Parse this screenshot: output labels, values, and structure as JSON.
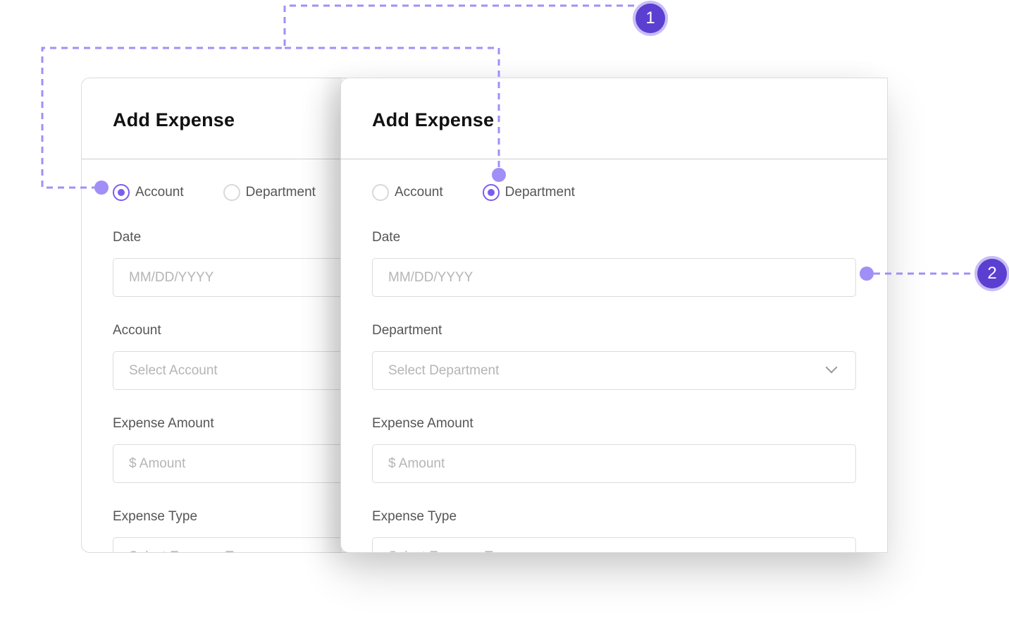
{
  "cards": [
    {
      "title": "Add Expense",
      "radios": [
        {
          "label": "Account",
          "selected": true
        },
        {
          "label": "Department",
          "selected": false
        }
      ],
      "fields": [
        {
          "label": "Date",
          "placeholder": "MM/DD/YYYY"
        },
        {
          "label": "Account",
          "placeholder": "Select Account"
        },
        {
          "label": "Expense Amount",
          "placeholder": "$ Amount"
        },
        {
          "label": "Expense Type",
          "placeholder": "Select Expense Type"
        }
      ]
    },
    {
      "title": "Add Expense",
      "radios": [
        {
          "label": "Account",
          "selected": false
        },
        {
          "label": "Department",
          "selected": true
        }
      ],
      "fields": [
        {
          "label": "Date",
          "placeholder": "MM/DD/YYYY"
        },
        {
          "label": "Department",
          "placeholder": "Select Department"
        },
        {
          "label": "Expense Amount",
          "placeholder": "$ Amount"
        },
        {
          "label": "Expense Type",
          "placeholder": "Select Expense Type"
        }
      ]
    }
  ],
  "annotations": [
    {
      "number": "1"
    },
    {
      "number": "2"
    }
  ],
  "colors": {
    "accent": "#7b5cf0",
    "badge": "#5b3fd0",
    "connector": "#a18ff7"
  }
}
